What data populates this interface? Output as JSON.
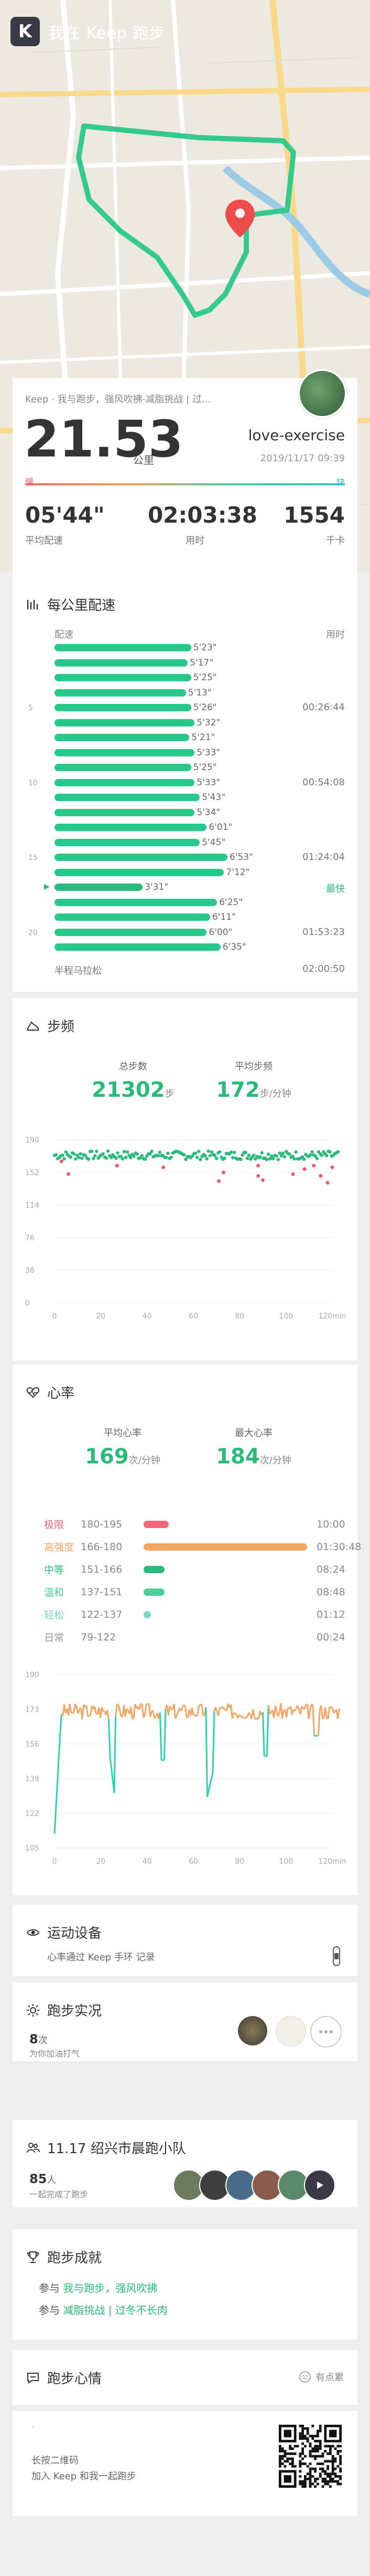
{
  "app": {
    "title": "我在 Keep 跑步",
    "logo": "K"
  },
  "summary": {
    "subtitle": "Keep · 我与跑步，强风吹拂·减脂挑战 | 过...",
    "distance": "21.53",
    "distance_unit": "公里",
    "username": "love-exercise",
    "datetime": "2019/11/17 09:39",
    "slow_label": "慢",
    "fast_label": "快",
    "avg_pace": "05'44\"",
    "avg_pace_label": "平均配速",
    "duration": "02:03:38",
    "duration_label": "用时",
    "calories": "1554",
    "calories_label": "千卡"
  },
  "pace": {
    "title": "每公里配速",
    "col_pace": "配速",
    "col_time": "用时",
    "km_ticks": [
      "5",
      "10",
      "15",
      "20"
    ],
    "values": [
      "5'23\"",
      "5'17\"",
      "5'25\"",
      "5'13\"",
      "5'26\"",
      "5'32\"",
      "5'21\"",
      "5'33\"",
      "5'25\"",
      "5'33\"",
      "5'43\"",
      "5'34\"",
      "6'01\"",
      "5'45\"",
      "6'53\"",
      "7'12\"",
      "3'31\"",
      "6'25\"",
      "6'11\"",
      "6'00\"",
      "6'35\""
    ],
    "fractions": [
      0.79,
      0.77,
      0.79,
      0.76,
      0.79,
      0.81,
      0.78,
      0.81,
      0.79,
      0.81,
      0.84,
      0.81,
      0.88,
      0.84,
      1.0,
      0.98,
      0.51,
      0.94,
      0.9,
      0.88,
      0.96
    ],
    "times": [
      {
        "row": 4,
        "text": "00:26:44"
      },
      {
        "row": 9,
        "text": "00:54:08"
      },
      {
        "row": 14,
        "text": "01:24:04"
      },
      {
        "row": 16,
        "text": "最快",
        "fast": true
      },
      {
        "row": 19,
        "text": "01:53:23"
      }
    ],
    "half_marathon": "半程马拉松",
    "half_marathon_time": "02:00:50"
  },
  "steps": {
    "title": "步频",
    "total_label": "总步数",
    "total": "21302",
    "total_unit": "步",
    "avg_label": "平均步频",
    "avg": "172",
    "avg_unit": "步/分钟",
    "chart_data": {
      "type": "scatter",
      "y_ticks": [
        "190",
        "152",
        "114",
        "76",
        "38",
        "0"
      ],
      "x_ticks": [
        "0",
        "20",
        "40",
        "60",
        "80",
        "100",
        "120min"
      ],
      "ylim": [
        0,
        190
      ],
      "xlim": [
        0,
        120
      ],
      "normal_color": "#2aba7a",
      "outlier_color": "#ee5a6a"
    }
  },
  "heart": {
    "title": "心率",
    "avg_label": "平均心率",
    "avg": "169",
    "avg_unit": "次/分钟",
    "max_label": "最大心率",
    "max": "184",
    "max_unit": "次/分钟",
    "zones": [
      {
        "name": "极限",
        "range": "180-195",
        "time": "10:00",
        "color": "#ee6a7a",
        "frac": 0.12
      },
      {
        "name": "高强度",
        "range": "166-180",
        "time": "01:30:48",
        "color": "#f3a766",
        "frac": 0.78
      },
      {
        "name": "中等",
        "range": "151-166",
        "time": "08:24",
        "color": "#2aba7a",
        "frac": 0.1
      },
      {
        "name": "温和",
        "range": "137-151",
        "time": "08:48",
        "color": "#4cd097",
        "frac": 0.1
      },
      {
        "name": "轻松",
        "range": "122-137",
        "time": "01:12",
        "color": "#7ad8c0",
        "frac": 0.02
      },
      {
        "name": "日常",
        "range": "79-122",
        "time": "00:24",
        "color": "#bbbbbb",
        "frac": 0.0
      }
    ],
    "chart_data": {
      "type": "line",
      "y_ticks": [
        "190",
        "173",
        "156",
        "139",
        "122",
        "105"
      ],
      "x_ticks": [
        "0",
        "20",
        "40",
        "60",
        "80",
        "100",
        "120min"
      ],
      "ylim": [
        105,
        190
      ],
      "xlim": [
        0,
        120
      ]
    }
  },
  "equipment": {
    "title": "运动设备",
    "text": "心率通过 Keep 手环 记录"
  },
  "report": {
    "title": "跑步实况",
    "count": "8",
    "count_unit": "次",
    "sub": "为你加油打气"
  },
  "team": {
    "title": "11.17 绍兴市晨跑小队",
    "count": "85",
    "count_unit": "人",
    "sub": "一起完成了跑步"
  },
  "achievement": {
    "title": "跑步成就",
    "items": [
      {
        "prefix": "参与",
        "link": "我与跑步，强风吹拂"
      },
      {
        "prefix": "参与",
        "link": "减脂挑战 | 过冬不长肉"
      }
    ]
  },
  "mood": {
    "title": "跑步心情",
    "action": "有点累"
  },
  "qrcode": {
    "line1": "长按二维码",
    "line2": "加入 Keep 和我一起跑步"
  },
  "colors": {
    "green": "#2aba7a",
    "route": "#35c98e",
    "pin": "#ee4b4b"
  }
}
